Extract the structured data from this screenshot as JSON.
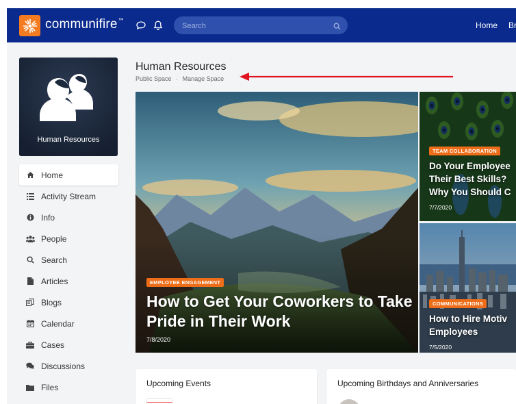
{
  "header": {
    "brand": "communifire",
    "brand_mark": "™",
    "search_placeholder": "Search",
    "nav": [
      "Home",
      "Br"
    ],
    "bg_color": "#0a2a8e",
    "logo_color": "#f47b20"
  },
  "space": {
    "tile_label": "Human Resources",
    "title": "Human Resources",
    "subtitle_links": [
      "Public Space",
      "·",
      "Manage Space"
    ]
  },
  "sidebar": {
    "items": [
      {
        "label": "Home",
        "icon": "home-icon",
        "active": true
      },
      {
        "label": "Activity Stream",
        "icon": "list-icon"
      },
      {
        "label": "Info",
        "icon": "info-icon"
      },
      {
        "label": "People",
        "icon": "people-icon"
      },
      {
        "label": "Search",
        "icon": "search-icon"
      },
      {
        "label": "Articles",
        "icon": "article-icon"
      },
      {
        "label": "Blogs",
        "icon": "blog-icon"
      },
      {
        "label": "Calendar",
        "icon": "calendar-icon"
      },
      {
        "label": "Cases",
        "icon": "briefcase-icon"
      },
      {
        "label": "Discussions",
        "icon": "comments-icon"
      },
      {
        "label": "Files",
        "icon": "folder-icon"
      }
    ]
  },
  "featured": {
    "main": {
      "category": "EMPLOYEE ENGAGEMENT",
      "title": "How to Get Your Coworkers to Take Pride in Their Work",
      "date": "7/8/2020"
    },
    "side": [
      {
        "category": "TEAM COLLABORATION",
        "title": "Do Your Employees Their Best Skills? Why You Should C",
        "title_lines": [
          "Do Your Employee",
          "Their Best Skills?",
          "Why You Should C"
        ],
        "date": "7/7/2020"
      },
      {
        "category": "COMMUNICATIONS",
        "title": "How to Hire Motiv Employees",
        "title_lines": [
          "How to Hire Motiv",
          "Employees"
        ],
        "date": "7/5/2020"
      }
    ],
    "badge_color": "#ee6d19"
  },
  "panels": {
    "events_title": "Upcoming Events",
    "birthdays_title": "Upcoming Birthdays and Anniversaries"
  }
}
